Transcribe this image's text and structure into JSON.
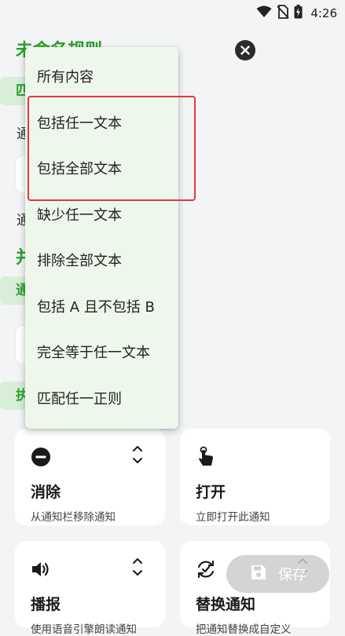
{
  "status": {
    "time": "4:26"
  },
  "header": {
    "title": "未命名规则"
  },
  "background_peeks": {
    "row1": "匹",
    "row2": "通",
    "row3": "通",
    "row4": "并",
    "row5": "通",
    "row6": "执"
  },
  "dropdown": {
    "items": [
      "所有内容",
      "包括任一文本",
      "包括全部文本",
      "缺少任一文本",
      "排除全部文本",
      "包括 A 且不包括 B",
      "完全等于任一文本",
      "匹配任一正则"
    ]
  },
  "cards": [
    {
      "title": "消除",
      "subtitle": "从通知栏移除通知",
      "icon": "minus-circle-icon"
    },
    {
      "title": "打开",
      "subtitle": "立即打开此通知",
      "icon": "tap-hand-icon"
    },
    {
      "title": "播报",
      "subtitle": "使用语音引擎朗读通知",
      "icon": "speaker-icon"
    },
    {
      "title": "替换通知",
      "subtitle": "把通知替换成自定义",
      "icon": "replace-icon"
    }
  ],
  "fab": {
    "label": "保存"
  },
  "colors": {
    "accent": "#2aa12a",
    "menu_bg": "#eef7ec",
    "highlight": "#e53935"
  }
}
